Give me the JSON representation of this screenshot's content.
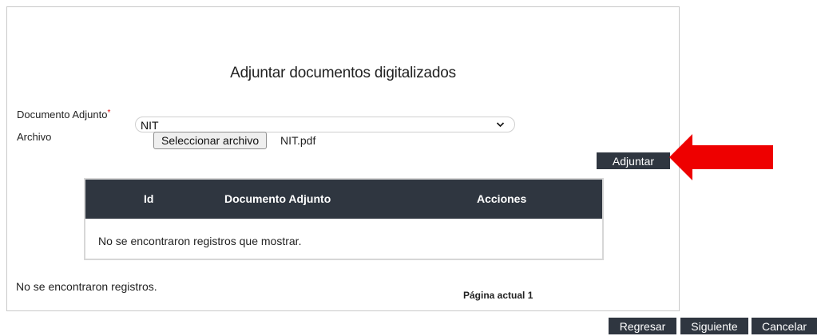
{
  "form": {
    "title": "Adjuntar documentos digitalizados",
    "doc_label": "Documento Adjunto",
    "required_mark": "*",
    "doc_selected": "NIT",
    "file_label": "Archivo",
    "file_button": "Seleccionar archivo",
    "file_name": "NIT.pdf",
    "attach_button": "Adjuntar"
  },
  "grid": {
    "columns": [
      "Id",
      "Documento Adjunto",
      "Acciones"
    ],
    "empty_text": "No se encontraron registros que mostrar."
  },
  "footer": {
    "empty_records": "No se encontraron registros.",
    "current_page": "Página actual 1"
  },
  "actions": {
    "back": "Regresar",
    "next": "Siguiente",
    "cancel": "Cancelar"
  },
  "colors": {
    "dark": "#2f3640",
    "arrow": "#ee0000",
    "required": "#dd0000"
  },
  "icons": {
    "dropdown": "chevron-down-icon",
    "pointer": "red-arrow-icon"
  }
}
